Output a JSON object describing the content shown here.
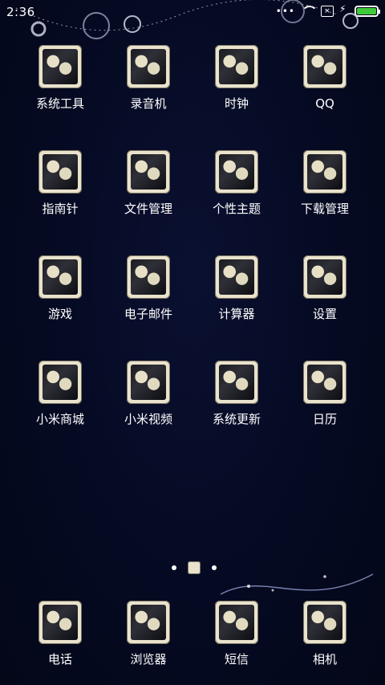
{
  "status": {
    "time": "2:36",
    "battery_color": "#3fcb3a"
  },
  "grid": [
    {
      "label": "系统工具"
    },
    {
      "label": "录音机"
    },
    {
      "label": "时钟"
    },
    {
      "label": "QQ"
    },
    {
      "label": "指南针"
    },
    {
      "label": "文件管理"
    },
    {
      "label": "个性主题"
    },
    {
      "label": "下载管理"
    },
    {
      "label": "游戏"
    },
    {
      "label": "电子邮件"
    },
    {
      "label": "计算器"
    },
    {
      "label": "设置"
    },
    {
      "label": "小米商城"
    },
    {
      "label": "小米视频"
    },
    {
      "label": "系统更新"
    },
    {
      "label": "日历"
    }
  ],
  "dock": [
    {
      "label": "电话"
    },
    {
      "label": "浏览器"
    },
    {
      "label": "短信"
    },
    {
      "label": "相机"
    }
  ]
}
